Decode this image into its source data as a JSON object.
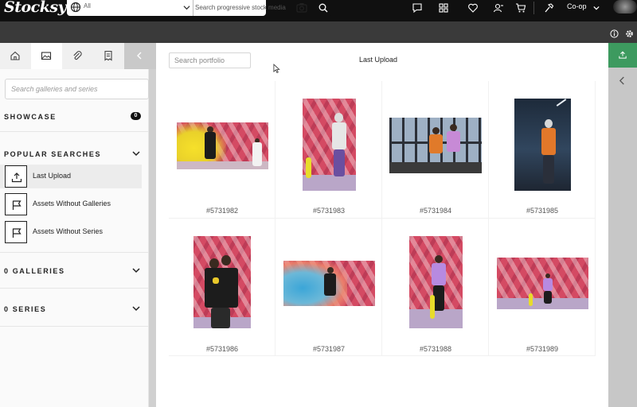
{
  "app": {
    "logo": "Stocksy"
  },
  "search": {
    "scope": "All",
    "placeholder": "Search progressive stock media"
  },
  "nav": {
    "account_label": "Co-op",
    "icons": [
      "chat-icon",
      "grid-icon",
      "heart-icon",
      "user-icon",
      "cart-icon",
      "hammer-icon"
    ]
  },
  "sidebar": {
    "tabs": [
      "home-icon",
      "image-icon",
      "paperclip-icon",
      "document-icon",
      "chevron-left-icon"
    ],
    "gallery_search_placeholder": "Search galleries and series",
    "showcase": {
      "title": "SHOWCASE",
      "count": "0"
    },
    "popular": {
      "title": "POPULAR SEARCHES",
      "items": [
        {
          "label": "Last Upload",
          "icon": "upload-icon",
          "active": true
        },
        {
          "label": "Assets Without Galleries",
          "icon": "flag-icon",
          "active": false
        },
        {
          "label": "Assets Without Series",
          "icon": "flag-icon",
          "active": false
        }
      ]
    },
    "galleries": {
      "title": "0 GALLERIES"
    },
    "series": {
      "title": "0 SERIES"
    }
  },
  "main": {
    "portfolio_search_placeholder": "Search portfolio",
    "title": "Last Upload",
    "assets": [
      {
        "id": "#5731982",
        "scene": "smoke-yellow-two-men"
      },
      {
        "id": "#5731983",
        "scene": "wall-skateboard-man"
      },
      {
        "id": "#5731984",
        "scene": "window-two-men-sitting"
      },
      {
        "id": "#5731985",
        "scene": "dark-garage-man"
      },
      {
        "id": "#5731986",
        "scene": "wall-two-men-hug"
      },
      {
        "id": "#5731987",
        "scene": "smoke-blue-man"
      },
      {
        "id": "#5731988",
        "scene": "wall-skateboard-man-2"
      },
      {
        "id": "#5731989",
        "scene": "wall-wide-man"
      }
    ]
  },
  "colors": {
    "topnav": "#101010",
    "subbar": "#3a3a3a",
    "upload_button": "#3d9a5f",
    "wall_pink": "#d44a63"
  }
}
